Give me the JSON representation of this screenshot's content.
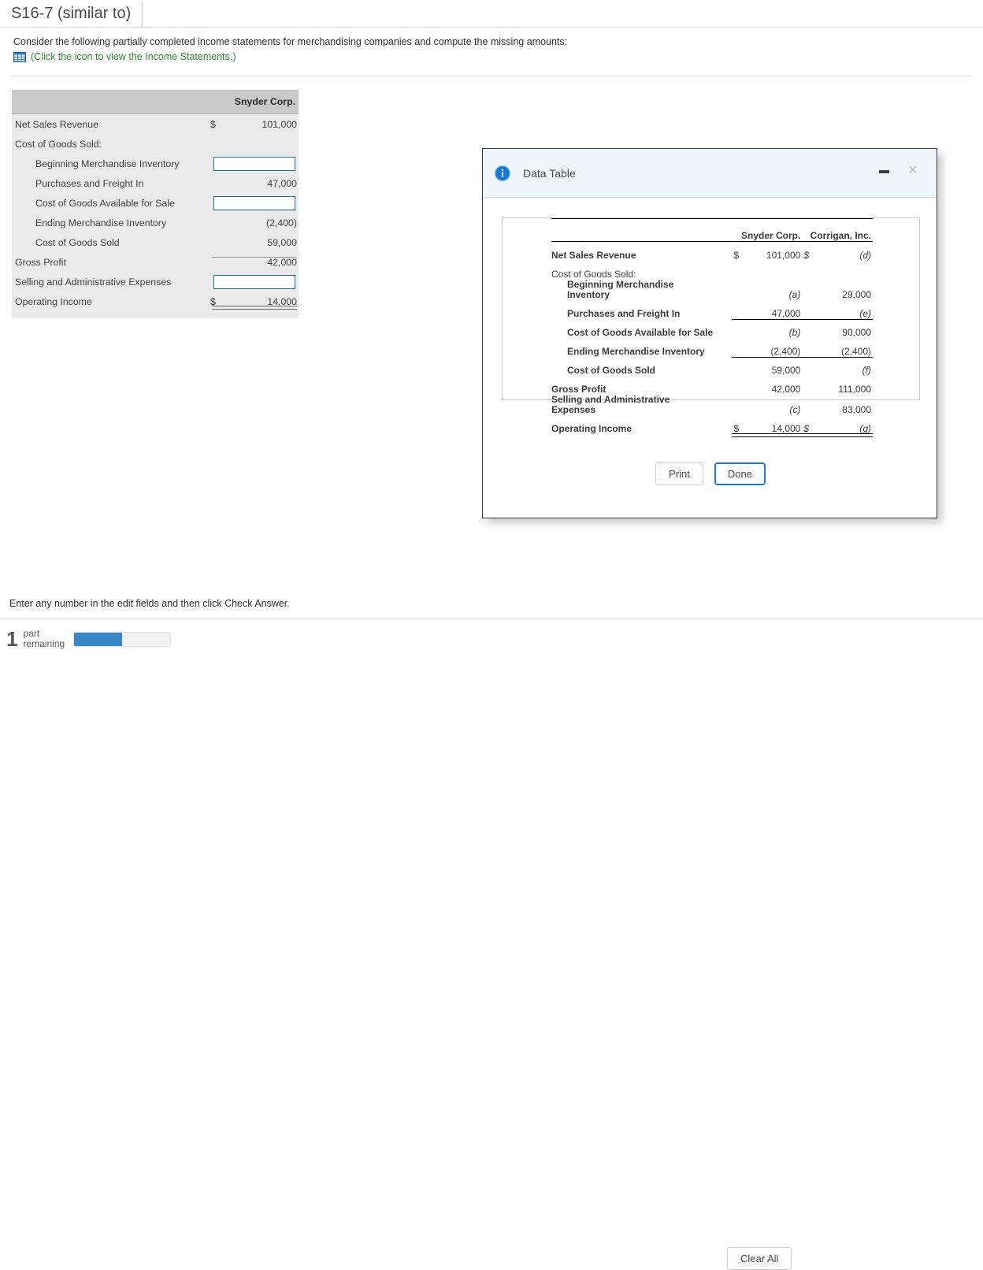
{
  "title_tab": {
    "label": "S16-7 (similar to)"
  },
  "prompt": {
    "text": "Consider the following partially completed income statements for merchandising companies and compute the missing amounts:",
    "link_text": "(Click the icon to view the Income Statements.)",
    "link_icon": "table-grid-icon",
    "link_color": "#2e8b30"
  },
  "worksheet": {
    "column_header": "Snyder Corp.",
    "rows": [
      {
        "label": "Net Sales Revenue",
        "indent": false,
        "currency": "$",
        "value": "101,000",
        "input": false
      },
      {
        "label": "Cost of Goods Sold:",
        "indent": false,
        "currency": "",
        "value": "",
        "input": false
      },
      {
        "label": "Beginning Merchandise Inventory",
        "indent": true,
        "currency": "",
        "value": "",
        "input": true
      },
      {
        "label": "Purchases and Freight In",
        "indent": true,
        "currency": "",
        "value": "47,000",
        "input": false
      },
      {
        "label": "Cost of Goods Available for Sale",
        "indent": true,
        "currency": "",
        "value": "",
        "input": true
      },
      {
        "label": "Ending Merchandise Inventory",
        "indent": true,
        "currency": "",
        "value": "(2,400)",
        "input": false
      },
      {
        "label": "Cost of Goods Sold",
        "indent": true,
        "currency": "",
        "value": "59,000",
        "input": false
      },
      {
        "label": "Gross Profit",
        "indent": false,
        "currency": "",
        "value": "42,000",
        "input": false
      },
      {
        "label": "Selling and Administrative Expenses",
        "indent": false,
        "currency": "",
        "value": "",
        "input": true
      },
      {
        "label": "Operating Income",
        "indent": false,
        "currency": "$",
        "value": "14,000",
        "input": false
      }
    ],
    "input_placeholder": "",
    "input_border_color": "#1a6e86"
  },
  "dialog": {
    "title": "Data Table",
    "info_icon": "info-circle-icon",
    "minimize_icon": "minimize-icon",
    "close_icon": "close-icon",
    "buttons": {
      "print": "Print",
      "done": "Done"
    },
    "table": {
      "col_headers": [
        "Snyder Corp.",
        "Corrigan, Inc."
      ],
      "rows": [
        {
          "label": "Net Sales Revenue",
          "bold": true,
          "indent": 0,
          "snyder_cur": "$",
          "snyder": "101,000",
          "snyder_ital": false,
          "corrigan_cur": "$",
          "corrigan": "(d)",
          "corrigan_ital": true
        },
        {
          "label": "Cost of Goods Sold:",
          "bold": false,
          "indent": 0,
          "snyder_cur": "",
          "snyder": "",
          "snyder_ital": false,
          "corrigan_cur": "",
          "corrigan": "",
          "corrigan_ital": false
        },
        {
          "label": "Beginning Merchandise Inventory",
          "bold": true,
          "indent": 1,
          "snyder_cur": "",
          "snyder": "(a)",
          "snyder_ital": true,
          "corrigan_cur": "",
          "corrigan": "29,000",
          "corrigan_ital": false
        },
        {
          "label": "Purchases and Freight In",
          "bold": true,
          "indent": 1,
          "snyder_cur": "",
          "snyder": "47,000",
          "snyder_ital": false,
          "corrigan_cur": "",
          "corrigan": "(e)",
          "corrigan_ital": true
        },
        {
          "label": "Cost of Goods Available for Sale",
          "bold": true,
          "indent": 1,
          "snyder_cur": "",
          "snyder": "(b)",
          "snyder_ital": true,
          "corrigan_cur": "",
          "corrigan": "90,000",
          "corrigan_ital": false
        },
        {
          "label": "Ending Merchandise Inventory",
          "bold": true,
          "indent": 1,
          "snyder_cur": "",
          "snyder": "(2,400)",
          "snyder_ital": false,
          "corrigan_cur": "",
          "corrigan": "(2,400)",
          "corrigan_ital": false
        },
        {
          "label": "Cost of Goods Sold",
          "bold": true,
          "indent": 1,
          "snyder_cur": "",
          "snyder": "59,000",
          "snyder_ital": false,
          "corrigan_cur": "",
          "corrigan": "(f)",
          "corrigan_ital": true
        },
        {
          "label": "Gross Profit",
          "bold": true,
          "indent": 0,
          "snyder_cur": "",
          "snyder": "42,000",
          "snyder_ital": false,
          "corrigan_cur": "",
          "corrigan": "111,000",
          "corrigan_ital": false
        },
        {
          "label": "Selling and Administrative Expenses",
          "bold": true,
          "indent": 0,
          "snyder_cur": "",
          "snyder": "(c)",
          "snyder_ital": true,
          "corrigan_cur": "",
          "corrigan": "83,000",
          "corrigan_ital": false
        },
        {
          "label": "Operating Income",
          "bold": true,
          "indent": 0,
          "snyder_cur": "$",
          "snyder": "14,000",
          "snyder_ital": false,
          "corrigan_cur": "$",
          "corrigan": "(g)",
          "corrigan_ital": true
        }
      ]
    }
  },
  "footer": {
    "note": "Enter any number in the edit fields and then click Check Answer.",
    "remaining_count": "1",
    "remaining_label_line1": "part",
    "remaining_label_line2": "remaining",
    "progress_percent": 50,
    "clear_all": "Clear All",
    "progress_color": "#3a87c8"
  }
}
